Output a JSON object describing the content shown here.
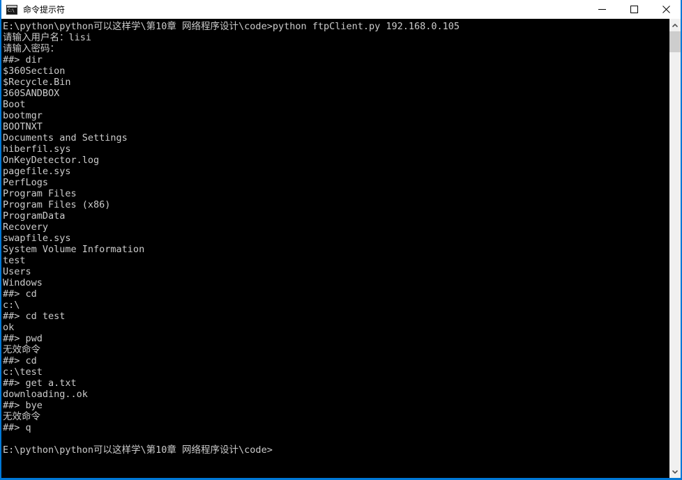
{
  "window": {
    "title": "命令提示符",
    "icon": "cmd-console-icon",
    "icon_glyph": "C:\\",
    "accent_color": "#0078d7",
    "titlebar_background": "#ffffff",
    "titlebar_text_color": "#000000",
    "controls": {
      "minimize": "minimize-button",
      "maximize": "maximize-button",
      "close": "close-button"
    }
  },
  "terminal": {
    "background_color": "#000000",
    "text_color": "#cccccc",
    "lines": [
      "E:\\python\\python可以这样学\\第10章 网络程序设计\\code>python ftpClient.py 192.168.0.105",
      "请输入用户名：lisi",
      "请输入密码：",
      "##> dir",
      "$360Section",
      "$Recycle.Bin",
      "360SANDBOX",
      "Boot",
      "bootmgr",
      "BOOTNXT",
      "Documents and Settings",
      "hiberfil.sys",
      "OnKeyDetector.log",
      "pagefile.sys",
      "PerfLogs",
      "Program Files",
      "Program Files (x86)",
      "ProgramData",
      "Recovery",
      "swapfile.sys",
      "System Volume Information",
      "test",
      "Users",
      "Windows",
      "##> cd",
      "c:\\",
      "##> cd test",
      "ok",
      "##> pwd",
      "无效命令",
      "##> cd",
      "c:\\test",
      "##> get a.txt",
      "downloading..ok",
      "##> bye",
      "无效命令",
      "##> q",
      "",
      "E:\\python\\python可以这样学\\第10章 网络程序设计\\code>"
    ]
  },
  "scrollbar": {
    "up_arrow": "scroll-up-arrow-icon",
    "down_arrow": "scroll-down-arrow-icon",
    "thumb": "scrollbar-thumb",
    "track_color": "#f0f0f0",
    "thumb_color": "#cdcdcd"
  }
}
